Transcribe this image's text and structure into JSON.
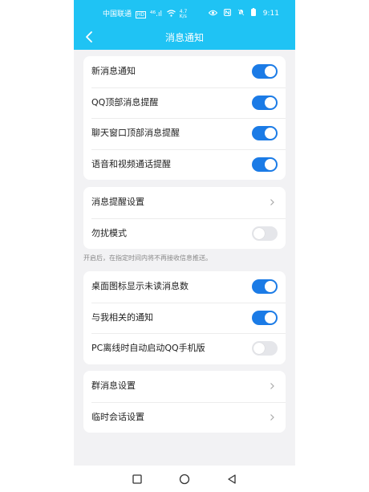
{
  "status_bar": {
    "carrier": "中国联通",
    "hd": "HD",
    "signal": "⁴⁶.ıl",
    "net_speed_top": "4.7",
    "net_speed_bottom": "K/s",
    "time": "9:11",
    "battery": "▮"
  },
  "header": {
    "title": "消息通知"
  },
  "group1": {
    "items": [
      {
        "label": "新消息通知",
        "on": true
      },
      {
        "label": "QQ顶部消息提醒",
        "on": true
      },
      {
        "label": "聊天窗口顶部消息提醒",
        "on": true
      },
      {
        "label": "语音和视频通话提醒",
        "on": true
      }
    ]
  },
  "group2": {
    "items": [
      {
        "label": "消息提醒设置"
      },
      {
        "label": "勿扰模式",
        "on": false
      }
    ]
  },
  "hint": "开启后，在指定时间内将不再接收信息推送。",
  "group3": {
    "items": [
      {
        "label": "桌面图标显示未读消息数",
        "on": true
      },
      {
        "label": "与我相关的通知",
        "on": true
      },
      {
        "label": "PC离线时自动启动QQ手机版",
        "on": false
      }
    ]
  },
  "group4": {
    "items": [
      {
        "label": "群消息设置"
      },
      {
        "label": "临时会话设置"
      }
    ]
  },
  "colors": {
    "accent": "#1fc3f4",
    "switch_on": "#1b7be6",
    "switch_off": "#e5e6ea"
  }
}
